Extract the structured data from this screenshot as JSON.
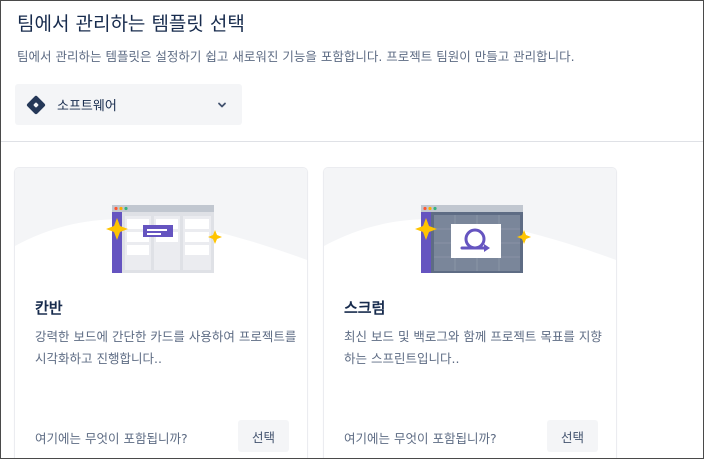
{
  "header": {
    "title": "팀에서 관리하는 템플릿 선택",
    "description": "팀에서 관리하는 템플릿은 설정하기 쉽고 새로워진 기능을 포함합니다. 프로젝트 팀원이 만들고 관리합니다."
  },
  "project_type": {
    "selected": "소프트웨어",
    "icon": "jira-diamond-icon"
  },
  "templates": [
    {
      "name": "칸반",
      "description": "강력한 보드에 간단한 카드를 사용하여 프로젝트를 시각화하고 진행합니다..",
      "footer_question": "여기에는 무엇이 포함됩니까?",
      "select_label": "선택",
      "illustration": "kanban-board-illustration"
    },
    {
      "name": "스크럼",
      "description": "최신 보드 및 백로그와 함께 프로젝트 목표를 지향하는 스프린트입니다..",
      "footer_question": "여기에는 무엇이 포함됩니까?",
      "select_label": "선택",
      "illustration": "scrum-sprint-illustration"
    }
  ],
  "colors": {
    "title": "#172b4d",
    "muted": "#5e6c84",
    "purple": "#6554c0",
    "sparkle": "#ffc400",
    "button_bg": "#f4f5f7"
  }
}
